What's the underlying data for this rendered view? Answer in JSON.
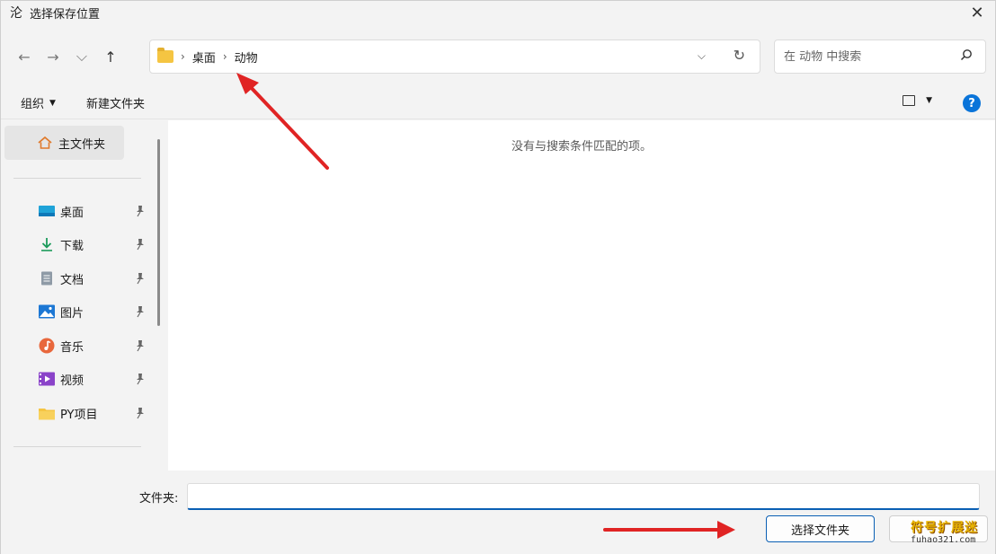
{
  "window": {
    "app_icon": "沦",
    "title": "选择保存位置",
    "close_glyph": "✕"
  },
  "nav": {
    "back_glyph": "←",
    "forward_glyph": "→",
    "recent_glyph": "⌵",
    "up_glyph": "↑"
  },
  "address": {
    "separator": "›",
    "crumbs": [
      "桌面",
      "动物"
    ],
    "dropdown_glyph": "⌵",
    "refresh_glyph": "↻"
  },
  "search": {
    "placeholder": "在 动物 中搜索"
  },
  "toolbar": {
    "organize_label": "组织",
    "organize_caret": "▼",
    "new_folder_label": "新建文件夹",
    "view_caret": "▼",
    "help_glyph": "?"
  },
  "sidebar": {
    "home_label": "主文件夹",
    "items": [
      {
        "label": "桌面",
        "icon": "desktop-icon",
        "color": "#1fa3d8"
      },
      {
        "label": "下载",
        "icon": "download-icon",
        "color": "#1a9a5a"
      },
      {
        "label": "文档",
        "icon": "document-icon",
        "color": "#8e9aa6"
      },
      {
        "label": "图片",
        "icon": "pictures-icon",
        "color": "#1c77d4"
      },
      {
        "label": "音乐",
        "icon": "music-icon",
        "color": "#e8673c"
      },
      {
        "label": "视频",
        "icon": "video-icon",
        "color": "#8a43c9"
      },
      {
        "label": "PY项目",
        "icon": "folder-icon",
        "color": "#f5c542"
      }
    ]
  },
  "content": {
    "empty_message": "没有与搜索条件匹配的项。"
  },
  "bottom": {
    "folder_label": "文件夹:",
    "folder_value": "",
    "select_button": "选择文件夹"
  },
  "watermark": {
    "line1": "符号扩展迷",
    "line2": "fuhao321.com"
  },
  "colors": {
    "accent": "#0a5fb4",
    "annotation_arrow": "#e02424"
  }
}
